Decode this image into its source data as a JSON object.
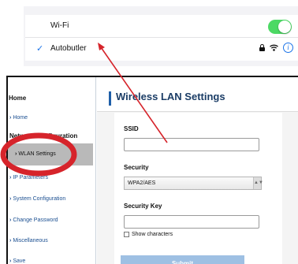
{
  "wifi": {
    "toggle_label": "Wi-Fi",
    "toggle_on": true,
    "connected_network": "Autobutler",
    "icons": [
      "checkmark-icon",
      "lock-icon",
      "wifi-signal-icon",
      "info-icon"
    ]
  },
  "admin": {
    "sidebar": {
      "home_title": "Home",
      "home_link": "Home",
      "section_title": "Network Configuration",
      "items": [
        {
          "label": "WLAN Settings",
          "active": true
        },
        {
          "label": "IP Parameters"
        },
        {
          "label": "System Configuration"
        },
        {
          "label": "Change Password"
        },
        {
          "label": "Miscellaneous"
        },
        {
          "label": "Save"
        }
      ]
    },
    "page_title": "Wireless LAN Settings",
    "form": {
      "ssid_label": "SSID",
      "ssid_value": "",
      "security_label": "Security",
      "security_selected": "WPA2/AES",
      "security_key_label": "Security Key",
      "security_key_value": "",
      "show_characters_label": "Show characters",
      "show_characters_checked": false,
      "submit_label": "Submit"
    }
  },
  "colors": {
    "toggle_on": "#4cd964",
    "link_blue": "#1b4f91",
    "title_navy": "#1b3d66",
    "submit_blue": "#9ec0e3",
    "annotation_red": "#d6242b"
  }
}
